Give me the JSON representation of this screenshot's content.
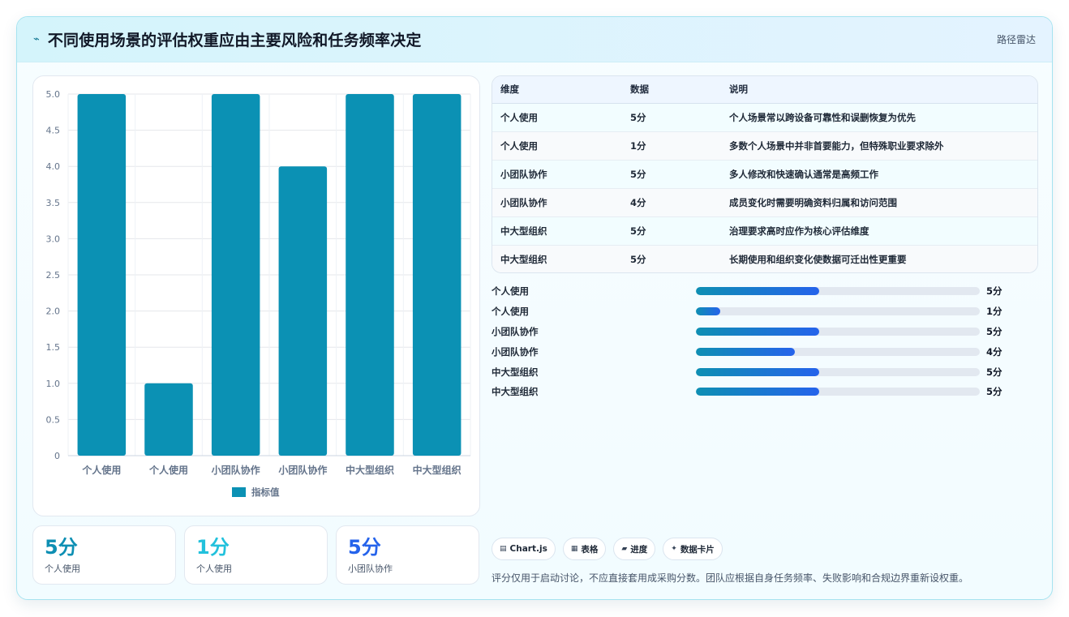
{
  "header": {
    "title": "不同使用场景的评估权重应由主要风险和任务频率决定",
    "tag": "路径雷达",
    "icon": "lightning-icon"
  },
  "chart_data": {
    "type": "bar",
    "categories": [
      "个人使用",
      "个人使用",
      "小团队协作",
      "小团队协作",
      "中大型组织",
      "中大型组织"
    ],
    "series": [
      {
        "name": "指标值",
        "values": [
          5,
          1,
          5,
          4,
          5,
          5
        ]
      }
    ],
    "yticks": [
      "0",
      "0.5",
      "1.0",
      "1.5",
      "2.0",
      "2.5",
      "3.0",
      "3.5",
      "4.0",
      "4.5",
      "5.0"
    ],
    "ylim": [
      0,
      5
    ],
    "grid": true,
    "legend": "bottom",
    "color": "#0b91b4"
  },
  "table": {
    "headers": [
      "维度",
      "数据",
      "说明"
    ],
    "rows": [
      [
        "个人使用",
        "5分",
        "个人场景常以跨设备可靠性和误删恢复为优先"
      ],
      [
        "个人使用",
        "1分",
        "多数个人场景中并非首要能力，但特殊职业要求除外"
      ],
      [
        "小团队协作",
        "5分",
        "多人修改和快速确认通常是高频工作"
      ],
      [
        "小团队协作",
        "4分",
        "成员变化时需要明确资料归属和访问范围"
      ],
      [
        "中大型组织",
        "5分",
        "治理要求高时应作为核心评估维度"
      ],
      [
        "中大型组织",
        "5分",
        "长期使用和组织变化使数据可迁出性更重要"
      ]
    ]
  },
  "progress": [
    {
      "label": "个人使用",
      "score": "5分",
      "fraction": 0.4357
    },
    {
      "label": "个人使用",
      "score": "1分",
      "fraction": 0.0871
    },
    {
      "label": "小团队协作",
      "score": "5分",
      "fraction": 0.4357
    },
    {
      "label": "小团队协作",
      "score": "4分",
      "fraction": 0.3486
    },
    {
      "label": "中大型组织",
      "score": "5分",
      "fraction": 0.4357
    },
    {
      "label": "中大型组织",
      "score": "5分",
      "fraction": 0.4357
    }
  ],
  "kpis": [
    {
      "value": "5分",
      "label": "个人使用",
      "color": "#0e8fb3"
    },
    {
      "value": "1分",
      "label": "个人使用",
      "color": "#22c1dc"
    },
    {
      "value": "5分",
      "label": "小团队协作",
      "color": "#2563eb"
    }
  ],
  "chips": [
    {
      "icon": "chart-icon",
      "glyph": "▤",
      "label": "Chart.js"
    },
    {
      "icon": "table-icon",
      "glyph": "▦",
      "label": "表格"
    },
    {
      "icon": "progress-icon",
      "glyph": "▰",
      "label": "进度"
    },
    {
      "icon": "sparkle-icon",
      "glyph": "✦",
      "label": "数据卡片"
    }
  ],
  "note": "评分仅用于启动讨论，不应直接套用成采购分数。团队应根据自身任务频率、失败影响和合规边界重新设权重。"
}
